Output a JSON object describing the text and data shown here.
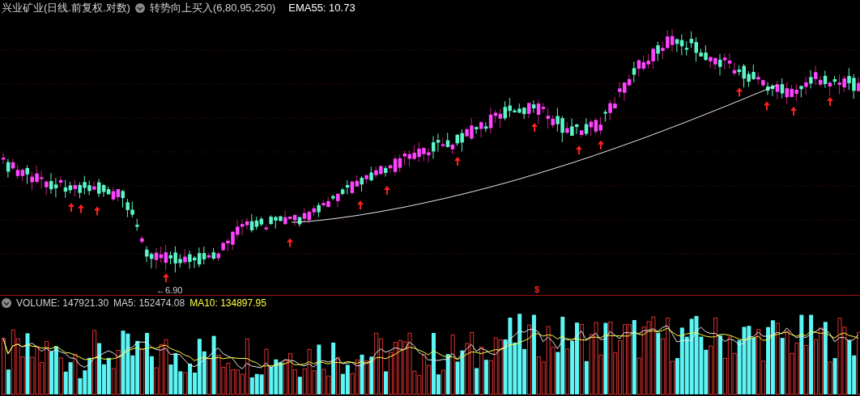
{
  "price_panel": {
    "stock_title": "兴业矿业(日线.前复权.对数)",
    "indicator_name": "转势向上买入(6,80,95,250)",
    "ema_label": "EMA55: 10.73",
    "low_label": "←6.90",
    "marker": "$"
  },
  "volume_panel": {
    "volume_label": "VOLUME: 147921.30",
    "ma5_label": "MA5: 152474.08",
    "ma10_label": "MA10: 134897.95"
  }
}
